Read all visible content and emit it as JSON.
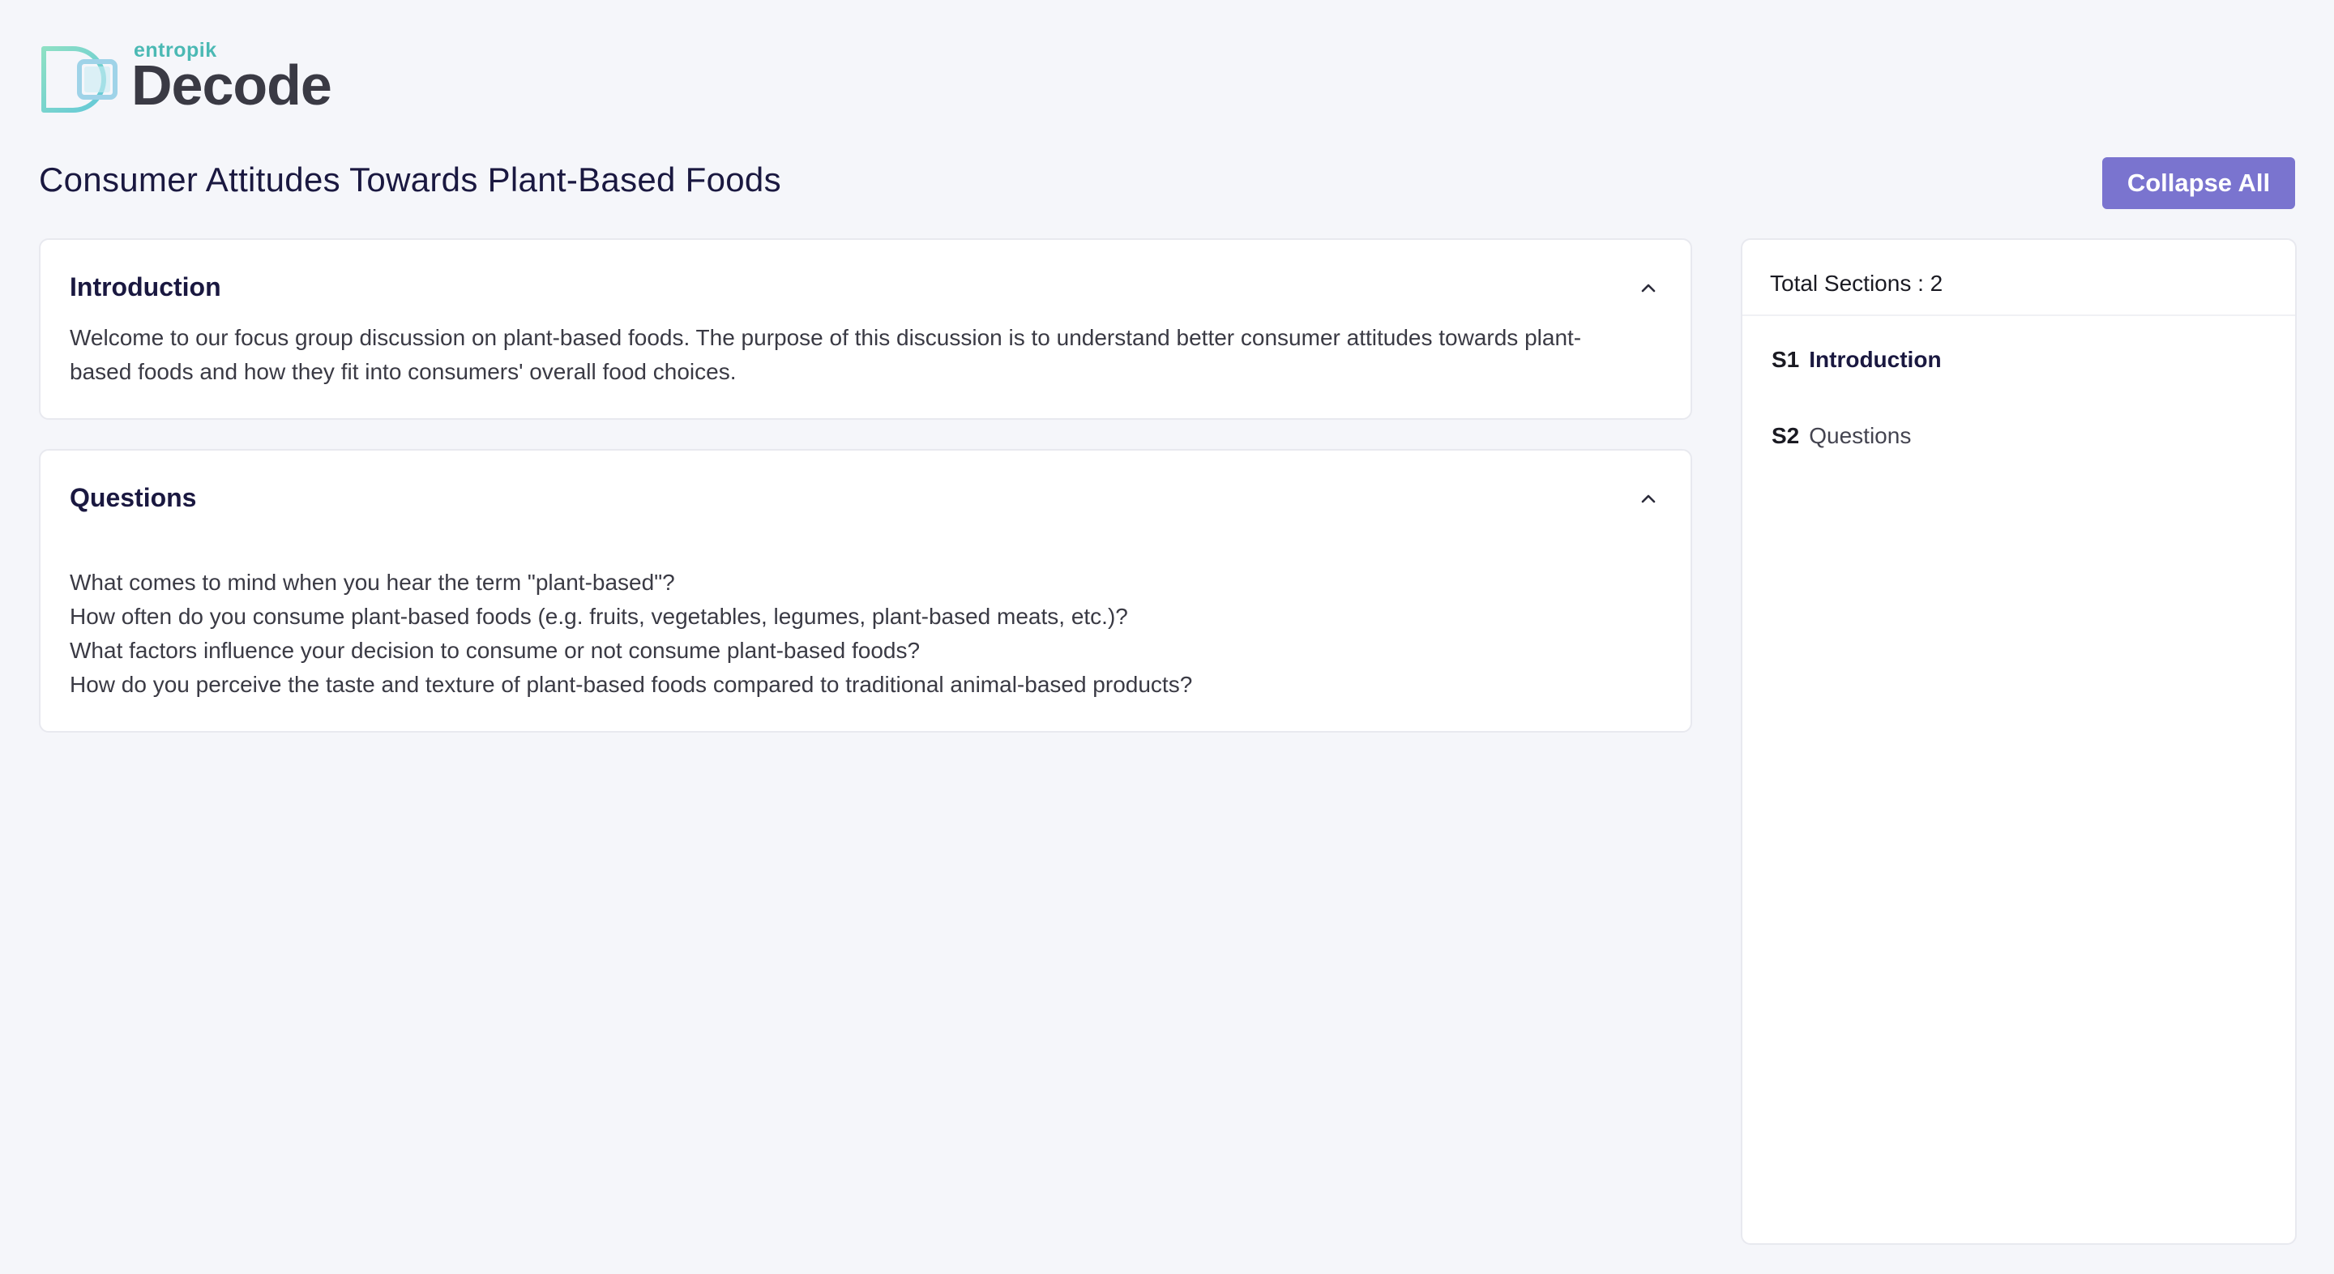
{
  "brand": {
    "small": "entropik",
    "name": "Decode",
    "colors": {
      "teal": "#4bb9b4",
      "mint": "#8ee0c4",
      "dark": "#3a3a44"
    }
  },
  "page": {
    "title": "Consumer Attitudes Towards Plant-Based Foods",
    "collapse_label": "Collapse All",
    "accent_color": "#7a74cf"
  },
  "sections": [
    {
      "title": "Introduction",
      "icon": "chevron-up-icon",
      "body": "Welcome to our focus group discussion on plant-based foods. The purpose of this discussion is to understand better consumer attitudes towards plant-based foods and how they fit into consumers' overall food choices."
    },
    {
      "title": "Questions",
      "icon": "chevron-up-icon",
      "lines": [
        "What comes to mind when you hear the term \"plant-based\"?",
        "How often do you consume plant-based foods (e.g. fruits, vegetables, legumes, plant-based meats, etc.)?",
        "What factors influence your decision to consume or not consume plant-based foods?",
        "How do you perceive the taste and texture of plant-based foods compared to traditional animal-based products?"
      ]
    }
  ],
  "sidebar": {
    "total_label": "Total Sections : 2",
    "items": [
      {
        "code": "S1",
        "label": "Introduction",
        "active": true
      },
      {
        "code": "S2",
        "label": "Questions",
        "active": false
      }
    ]
  }
}
